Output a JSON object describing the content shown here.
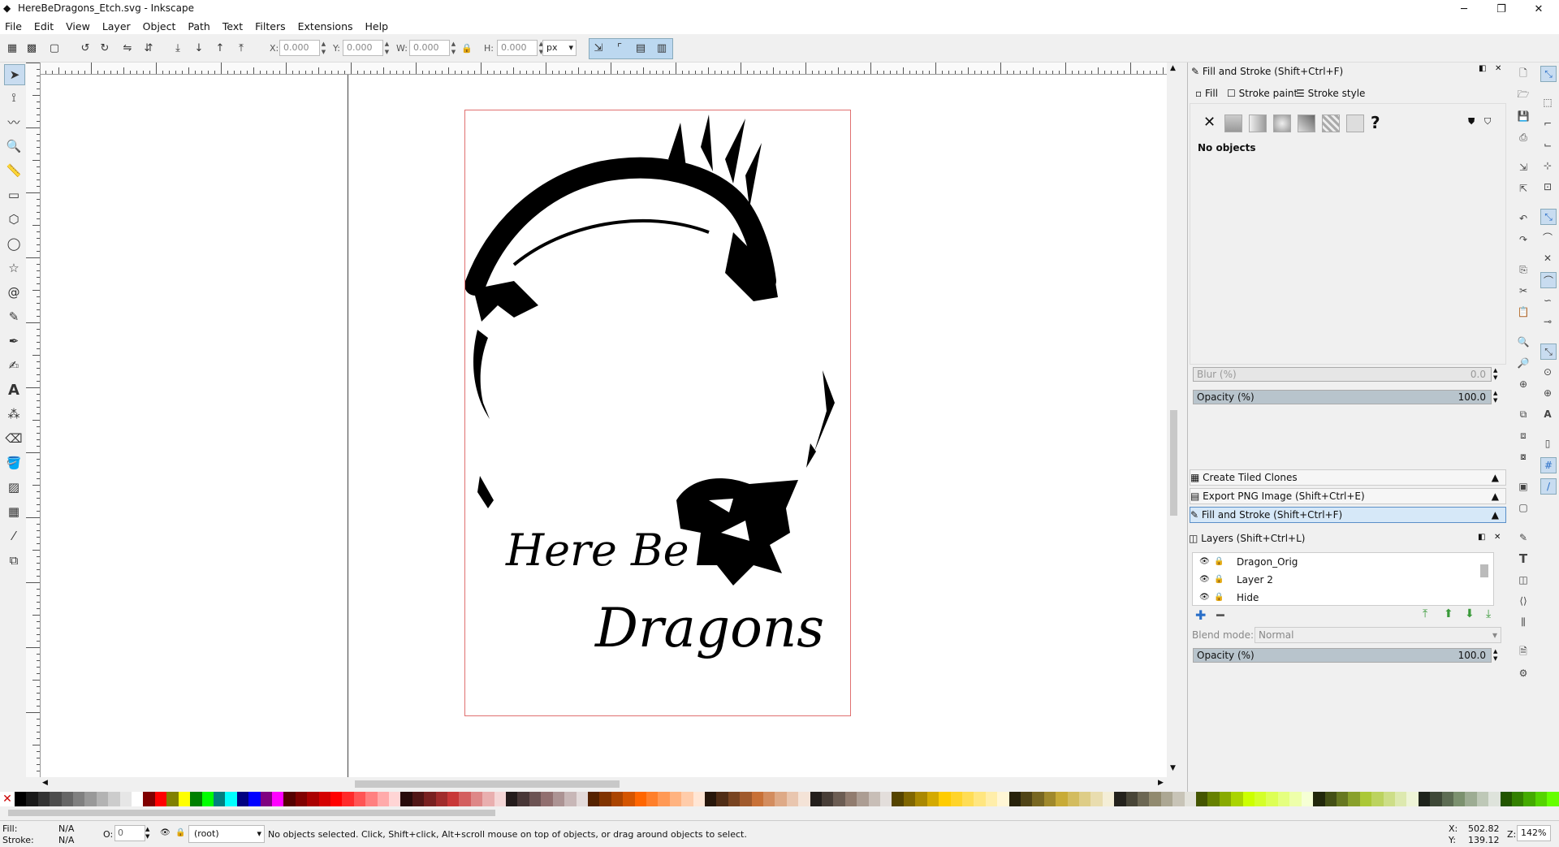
{
  "window": {
    "title": "HereBeDragons_Etch.svg - Inkscape"
  },
  "menu": [
    "File",
    "Edit",
    "View",
    "Layer",
    "Object",
    "Path",
    "Text",
    "Filters",
    "Extensions",
    "Help"
  ],
  "toolbar": {
    "x_label": "X:",
    "x_value": "0.000",
    "y_label": "Y:",
    "y_value": "0.000",
    "w_label": "W:",
    "w_value": "0.000",
    "h_label": "H:",
    "h_value": "0.000",
    "unit": "px"
  },
  "artwork": {
    "line1": "Here Be",
    "line2": "Dragons"
  },
  "fill_stroke": {
    "title": "Fill and Stroke (Shift+Ctrl+F)",
    "tabs": [
      "Fill",
      "Stroke paint",
      "Stroke style"
    ],
    "status": "No objects",
    "blur_label": "Blur (%)",
    "blur_value": "0.0",
    "opacity_label": "Opacity (%)",
    "opacity_value": "100.0"
  },
  "collapsed_panels": [
    "Create Tiled Clones",
    "Export PNG Image (Shift+Ctrl+E)",
    "Fill and Stroke (Shift+Ctrl+F)"
  ],
  "layers": {
    "title": "Layers (Shift+Ctrl+L)",
    "items": [
      "Dragon_Orig",
      "Layer 2",
      "Hide"
    ],
    "blend_label": "Blend mode:",
    "blend_value": "Normal",
    "opacity_label": "Opacity (%)",
    "opacity_value": "100.0"
  },
  "status": {
    "fill_label": "Fill:",
    "fill_value": "N/A",
    "stroke_label": "Stroke:",
    "stroke_value": "N/A",
    "o_label": "O:",
    "o_value": "0",
    "layer": "(root)",
    "message": "No objects selected. Click, Shift+click, Alt+scroll mouse on top of objects, or drag around objects to select.",
    "x_label": "X:",
    "x_value": "502.82",
    "y_label": "Y:",
    "y_value": "139.12",
    "z_label": "Z:",
    "zoom": "142%"
  },
  "palette": [
    "#000000",
    "#1a1a1a",
    "#333333",
    "#4d4d4d",
    "#666666",
    "#808080",
    "#999999",
    "#b3b3b3",
    "#cccccc",
    "#e6e6e6",
    "#ffffff",
    "#800000",
    "#ff0000",
    "#808000",
    "#ffff00",
    "#008000",
    "#00ff00",
    "#008080",
    "#00ffff",
    "#000080",
    "#0000ff",
    "#800080",
    "#ff00ff",
    "#550000",
    "#800000",
    "#aa0000",
    "#d40000",
    "#ff0000",
    "#ff2a2a",
    "#ff5555",
    "#ff8080",
    "#ffaaaa",
    "#ffd5d5",
    "#280b0b",
    "#501616",
    "#782121",
    "#a02c2c",
    "#c83737",
    "#d35f5f",
    "#de8787",
    "#e9afaf",
    "#f4d7d7",
    "#241c1c",
    "#483737",
    "#6c5353",
    "#916f6f",
    "#ac9393",
    "#c8b7b7",
    "#e3dbdb",
    "#552200",
    "#803300",
    "#aa4400",
    "#d45500",
    "#ff6600",
    "#ff7f2a",
    "#ff9955",
    "#ffb380",
    "#ffccaa",
    "#ffe6d5",
    "#28170b",
    "#502d16",
    "#784421",
    "#a05a2c",
    "#c87137",
    "#d38d5f",
    "#deaa87",
    "#e9c6af",
    "#f4e3d7",
    "#241f1c",
    "#483e37",
    "#6c5d53",
    "#917c6f",
    "#ac9d93",
    "#c8beb7",
    "#e3dedb",
    "#554400",
    "#806600",
    "#aa8800",
    "#d4aa00",
    "#ffcc00",
    "#ffd42a",
    "#ffdd55",
    "#ffe680",
    "#ffeeaa",
    "#fff6d5",
    "#28220b",
    "#504416",
    "#786721",
    "#a0892c",
    "#c8ab37",
    "#d3bc5f",
    "#decd87",
    "#e9ddaf",
    "#f4eed7",
    "#24221c",
    "#484537",
    "#6c6753",
    "#918a6f",
    "#aca793",
    "#c8c4b7",
    "#e3e2db",
    "#445500",
    "#668000",
    "#88aa00",
    "#aad400",
    "#ccff00",
    "#d4ff2a",
    "#ddff55",
    "#e5ff80",
    "#eeffaa",
    "#f6ffd5",
    "#22280b",
    "#445016",
    "#677821",
    "#89a02c",
    "#abc837",
    "#bcd35f",
    "#cdde87",
    "#dde9af",
    "#eef4d7",
    "#1f241c",
    "#3e4837",
    "#5d6c53",
    "#7c916f",
    "#9dac93",
    "#bec8b7",
    "#dee3db",
    "#225500",
    "#338000",
    "#44aa00",
    "#55d400",
    "#66ff00"
  ]
}
